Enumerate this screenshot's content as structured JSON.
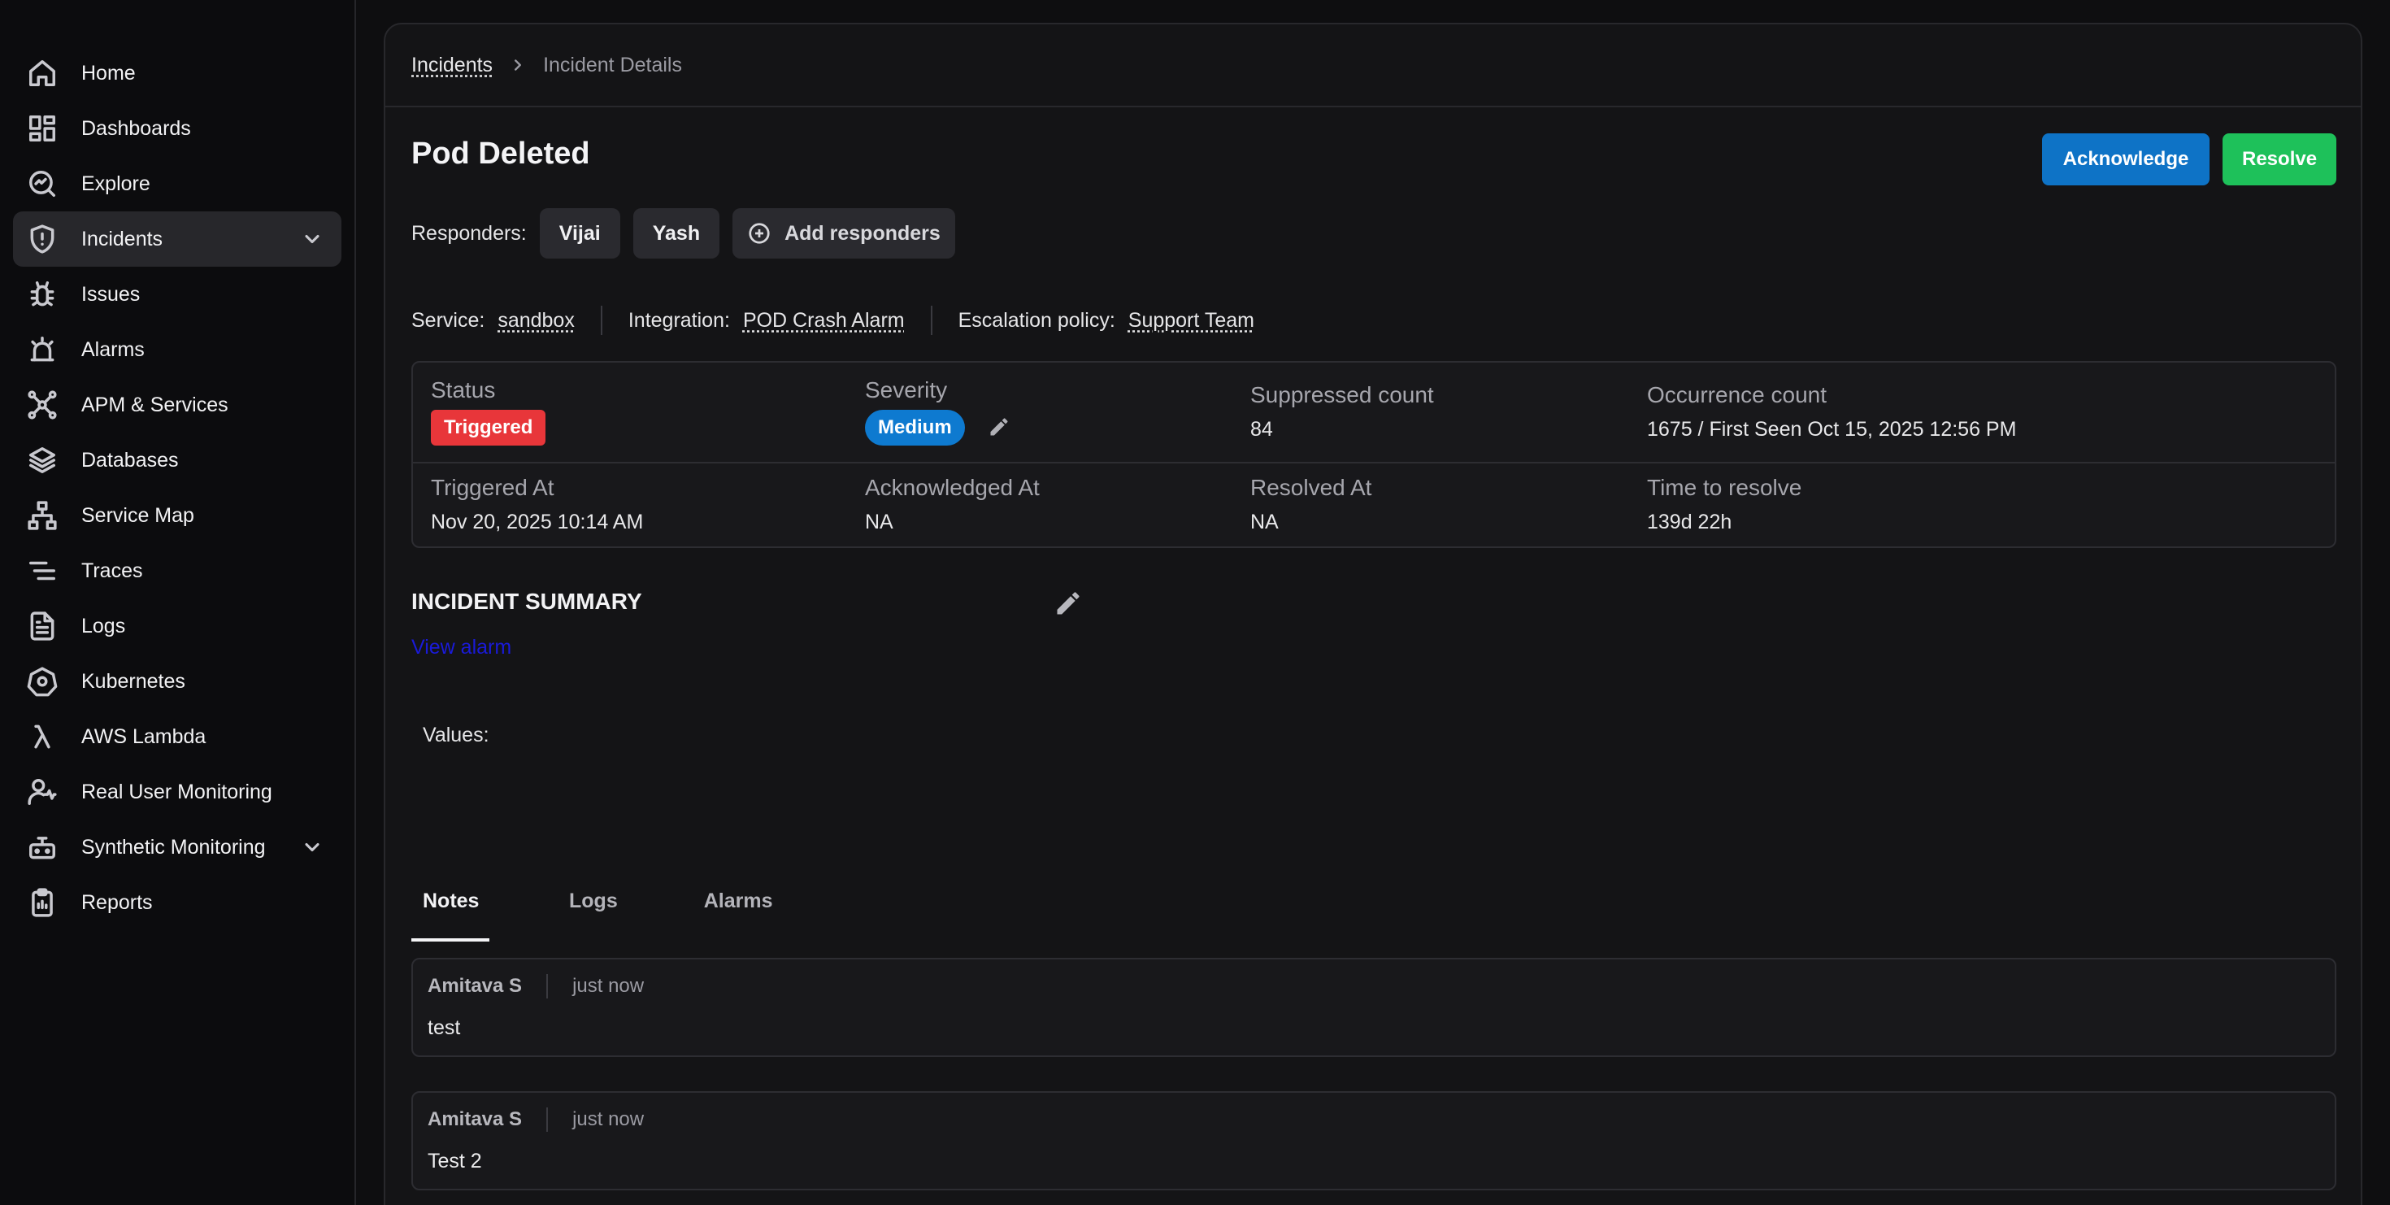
{
  "sidebar": {
    "items": [
      {
        "label": "Home",
        "icon": "home-icon"
      },
      {
        "label": "Dashboards",
        "icon": "dashboard-icon"
      },
      {
        "label": "Explore",
        "icon": "explore-icon"
      },
      {
        "label": "Incidents",
        "icon": "shield-icon",
        "active": true,
        "expandable": true
      },
      {
        "label": "Issues",
        "icon": "bug-icon"
      },
      {
        "label": "Alarms",
        "icon": "siren-icon"
      },
      {
        "label": "APM & Services",
        "icon": "network-icon"
      },
      {
        "label": "Databases",
        "icon": "layers-icon"
      },
      {
        "label": "Service Map",
        "icon": "sitemap-icon"
      },
      {
        "label": "Traces",
        "icon": "traces-icon"
      },
      {
        "label": "Logs",
        "icon": "file-text-icon"
      },
      {
        "label": "Kubernetes",
        "icon": "kubernetes-icon"
      },
      {
        "label": "AWS Lambda",
        "icon": "lambda-icon"
      },
      {
        "label": "Real User Monitoring",
        "icon": "user-monitor-icon"
      },
      {
        "label": "Synthetic Monitoring",
        "icon": "robot-icon",
        "expandable": true
      },
      {
        "label": "Reports",
        "icon": "clipboard-icon"
      }
    ]
  },
  "breadcrumb": {
    "parent": "Incidents",
    "current": "Incident Details"
  },
  "incident": {
    "title": "Pod Deleted",
    "acknowledge_label": "Acknowledge",
    "resolve_label": "Resolve",
    "responders_label": "Responders:",
    "responders": [
      "Vijai",
      "Yash"
    ],
    "add_responders_label": "Add responders",
    "service_label": "Service:",
    "service": "sandbox",
    "integration_label": "Integration:",
    "integration": "POD Crash Alarm",
    "escalation_label": "Escalation policy:",
    "escalation": "Support Team"
  },
  "status": {
    "status_label": "Status",
    "status_value": "Triggered",
    "severity_label": "Severity",
    "severity_value": "Medium",
    "suppressed_label": "Suppressed count",
    "suppressed_value": "84",
    "occurrence_label": "Occurrence count",
    "occurrence_value": "1675 / First Seen Oct 15, 2025 12:56 PM",
    "triggered_at_label": "Triggered At",
    "triggered_at_value": "Nov 20, 2025 10:14 AM",
    "acknowledged_at_label": "Acknowledged At",
    "acknowledged_at_value": "NA",
    "resolved_at_label": "Resolved At",
    "resolved_at_value": "NA",
    "ttr_label": "Time to resolve",
    "ttr_value": "139d 22h"
  },
  "summary": {
    "title": "INCIDENT SUMMARY",
    "view_alarm": "View alarm",
    "values_label": "Values:"
  },
  "tabs": [
    {
      "label": "Notes",
      "active": true
    },
    {
      "label": "Logs"
    },
    {
      "label": "Alarms"
    }
  ],
  "notes": [
    {
      "author": "Amitava S",
      "time": "just now",
      "body": "test"
    },
    {
      "author": "Amitava S",
      "time": "just now",
      "body": "Test 2"
    }
  ],
  "colors": {
    "acknowledge": "#0e73c6",
    "resolve": "#1ec15a",
    "triggered": "#e8363a",
    "medium": "#0e7ad0",
    "link": "#1a1ad8"
  }
}
